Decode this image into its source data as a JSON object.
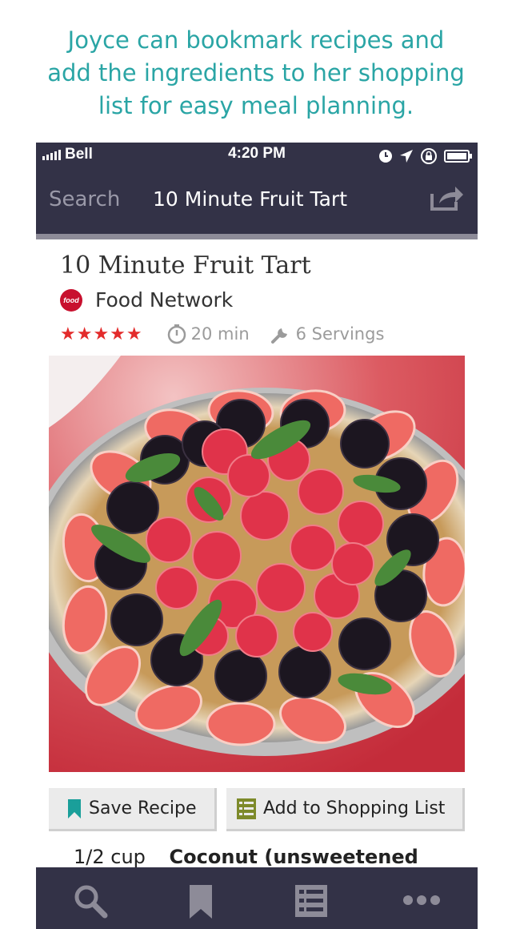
{
  "headline": {
    "line1": "Joyce can bookmark recipes and",
    "line2": "add the ingredients to her shopping",
    "line3": "list for easy meal planning."
  },
  "status_bar": {
    "carrier": "Bell",
    "time": "4:20 PM",
    "icons": [
      "signal-icon",
      "clock-icon",
      "location-icon",
      "rotation-lock-icon",
      "battery-icon"
    ]
  },
  "nav": {
    "back_label": "Search",
    "title": "10 Minute Fruit Tart",
    "share_icon": "share-icon"
  },
  "recipe": {
    "title": "10 Minute Fruit Tart",
    "source": "Food Network",
    "source_logo_text": "food",
    "rating": 5,
    "stars": "★★★★★",
    "time": "20 min",
    "servings": "6 Servings",
    "image_alt": "fruit tart with strawberries, raspberries, blackberries and mint"
  },
  "actions": {
    "save_label": "Save Recipe",
    "shopping_label": "Add to Shopping List"
  },
  "ingredients": [
    {
      "qty": "1/2 cup",
      "name": "Coconut (unsweetened"
    }
  ],
  "tabs": [
    "search-icon",
    "bookmark-icon",
    "list-icon",
    "more-icon"
  ],
  "colors": {
    "accent": "#2aa5a5",
    "bar": "#333247",
    "stars": "#e32b2b",
    "save_icon": "#1a9f9a",
    "list_icon": "#7d8a2a"
  }
}
